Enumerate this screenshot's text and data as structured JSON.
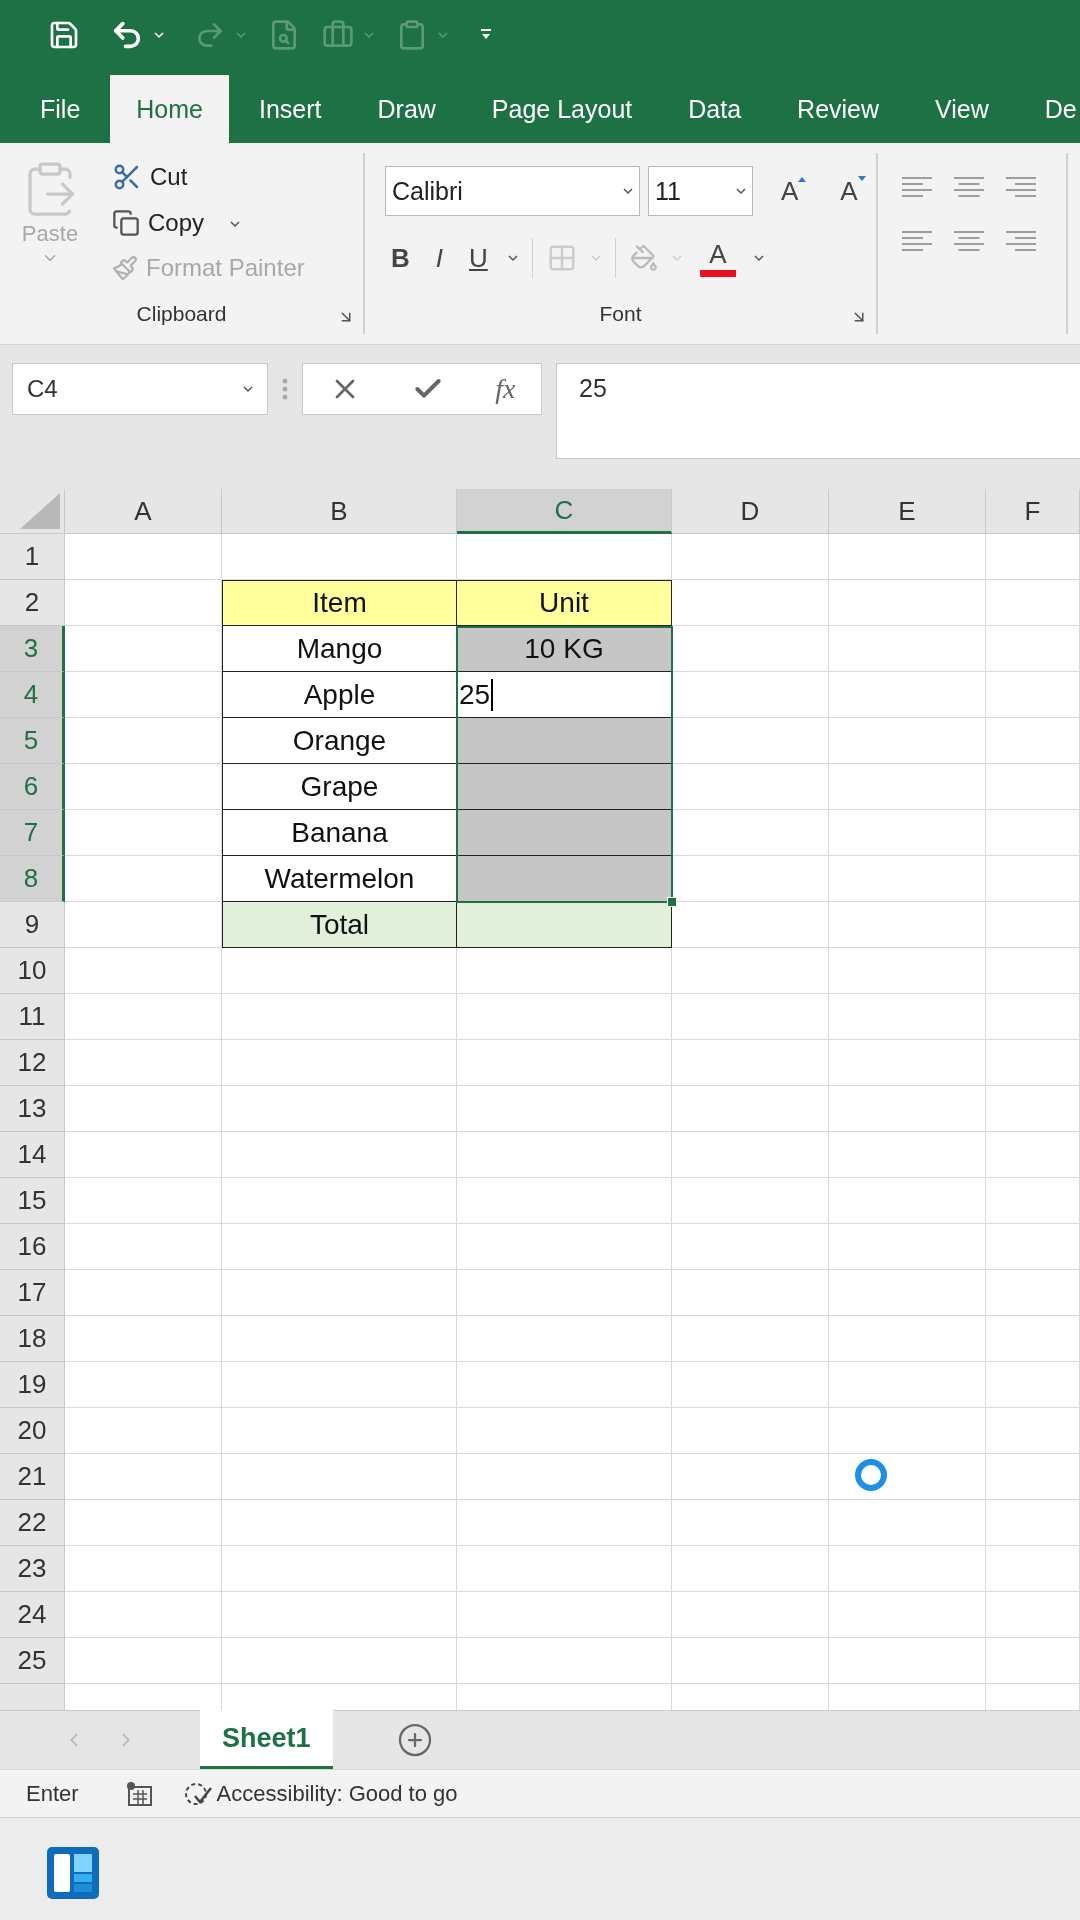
{
  "tabs": [
    {
      "label": "File",
      "selected": false
    },
    {
      "label": "Home",
      "selected": true
    },
    {
      "label": "Insert",
      "selected": false
    },
    {
      "label": "Draw",
      "selected": false
    },
    {
      "label": "Page Layout",
      "selected": false
    },
    {
      "label": "Data",
      "selected": false
    },
    {
      "label": "Review",
      "selected": false
    },
    {
      "label": "View",
      "selected": false
    },
    {
      "label": "De",
      "selected": false
    }
  ],
  "clipboard": {
    "group_label": "Clipboard",
    "paste": {
      "label": "Paste",
      "disabled": true
    },
    "items": [
      {
        "kind": "cut",
        "label": "Cut",
        "disabled": false
      },
      {
        "kind": "copy",
        "label": "Copy",
        "disabled": false
      },
      {
        "kind": "painter",
        "label": "Format Painter",
        "disabled": true
      }
    ]
  },
  "font": {
    "group_label": "Font",
    "name": "Calibri",
    "size": "11",
    "grow_label": "A",
    "shrink_label": "A",
    "styles": [
      {
        "kind": "bold",
        "label": "B"
      },
      {
        "kind": "italic",
        "label": "I"
      },
      {
        "kind": "underline",
        "label": "U"
      }
    ],
    "color_label": "A",
    "color": "#e81123"
  },
  "formula_bar": {
    "name_box": "C4",
    "function_label": "fx",
    "value": "25"
  },
  "columns": [
    {
      "label": "A",
      "selected": false
    },
    {
      "label": "B",
      "selected": false
    },
    {
      "label": "C",
      "selected": true
    },
    {
      "label": "D",
      "selected": false
    },
    {
      "label": "E",
      "selected": false
    },
    {
      "label": "F",
      "selected": false
    }
  ],
  "rows": [
    {
      "number": "1",
      "selected": false
    },
    {
      "number": "2",
      "selected": false,
      "item": {
        "kind": "heading",
        "text": "Item"
      },
      "unit": {
        "kind": "heading",
        "text": "Unit",
        "selected": false,
        "editing": false
      }
    },
    {
      "number": "3",
      "selected": true,
      "item": {
        "kind": "body",
        "text": "Mango"
      },
      "unit": {
        "kind": "body",
        "text": "10 KG",
        "selected": true,
        "editing": false
      }
    },
    {
      "number": "4",
      "selected": true,
      "item": {
        "kind": "body",
        "text": "Apple"
      },
      "unit": {
        "kind": "body",
        "text": "25",
        "editing": true
      }
    },
    {
      "number": "5",
      "selected": true,
      "item": {
        "kind": "body",
        "text": "Orange"
      },
      "unit": {
        "kind": "body",
        "selected": true,
        "editing": false
      }
    },
    {
      "number": "6",
      "selected": true,
      "item": {
        "kind": "body",
        "text": "Grape"
      },
      "unit": {
        "kind": "body",
        "selected": true,
        "editing": false
      }
    },
    {
      "number": "7",
      "selected": true,
      "item": {
        "kind": "body",
        "text": "Banana"
      },
      "unit": {
        "kind": "body",
        "selected": true,
        "editing": false
      }
    },
    {
      "number": "8",
      "selected": true,
      "item": {
        "kind": "body",
        "text": "Watermelon"
      },
      "unit": {
        "kind": "body",
        "selected": true,
        "editing": false
      }
    },
    {
      "number": "9",
      "selected": false,
      "item": {
        "kind": "total",
        "text": "Total"
      },
      "unit": {
        "kind": "total",
        "selected": false,
        "editing": false
      }
    },
    {
      "number": "10",
      "selected": false
    },
    {
      "number": "11",
      "selected": false
    },
    {
      "number": "12",
      "selected": false
    },
    {
      "number": "13",
      "selected": false
    },
    {
      "number": "14",
      "selected": false
    },
    {
      "number": "15",
      "selected": false
    },
    {
      "number": "16",
      "selected": false
    },
    {
      "number": "17",
      "selected": false
    },
    {
      "number": "18",
      "selected": false
    },
    {
      "number": "19",
      "selected": false
    },
    {
      "number": "20",
      "selected": false
    },
    {
      "number": "21",
      "selected": false
    },
    {
      "number": "22",
      "selected": false
    },
    {
      "number": "23",
      "selected": false
    },
    {
      "number": "24",
      "selected": false
    },
    {
      "number": "25",
      "selected": false
    }
  ],
  "sheets": [
    {
      "label": "Sheet1",
      "selected": true
    }
  ],
  "status_bar": {
    "mode": "Enter",
    "accessibility": "Accessibility: Good to go"
  }
}
